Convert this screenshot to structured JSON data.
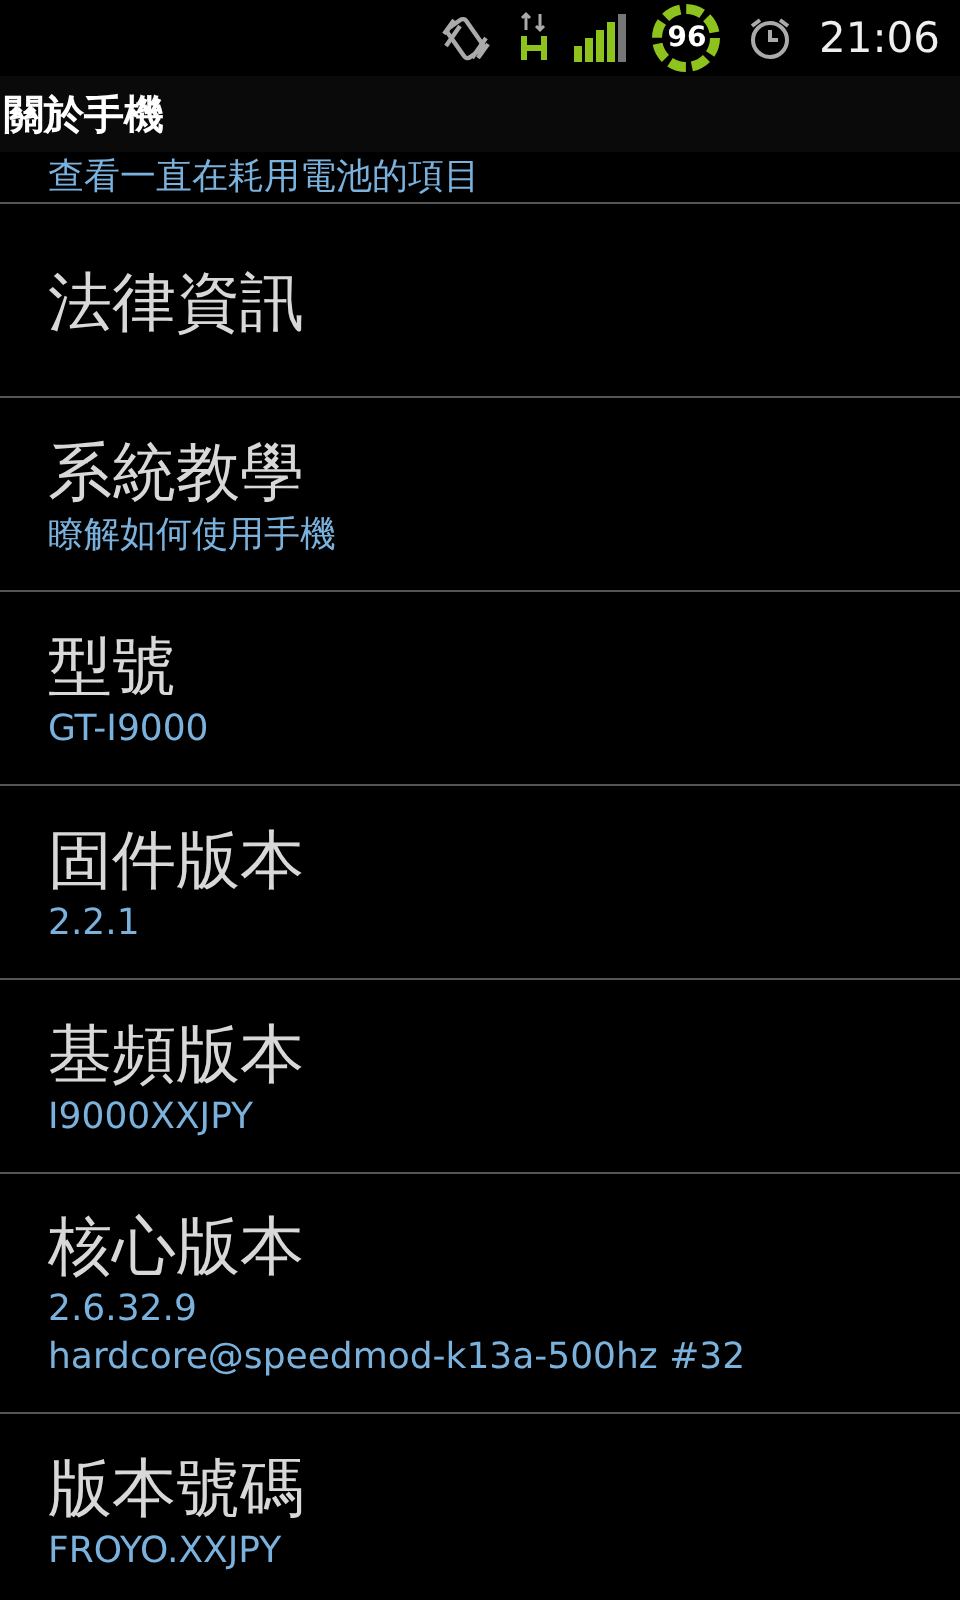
{
  "status_bar": {
    "battery": "96",
    "time": "21:06"
  },
  "window": {
    "title": "關於手機"
  },
  "items": [
    {
      "kind": "partial",
      "summary": [
        "查看一直在耗用電池的項目"
      ]
    },
    {
      "kind": "plain",
      "title": "法律資訊"
    },
    {
      "kind": "summary",
      "title": "系統教學",
      "summary": [
        "瞭解如何使用手機"
      ]
    },
    {
      "kind": "summary",
      "title": "型號",
      "summary": [
        "GT-I9000"
      ]
    },
    {
      "kind": "summary",
      "title": "固件版本",
      "summary": [
        "2.2.1"
      ]
    },
    {
      "kind": "summary",
      "title": "基頻版本",
      "summary": [
        "I9000XXJPY"
      ]
    },
    {
      "kind": "summary",
      "title": "核心版本",
      "summary": [
        "2.6.32.9",
        "hardcore@speedmod-k13a-500hz #32"
      ]
    },
    {
      "kind": "summary",
      "title": "版本號碼",
      "summary": [
        "FROYO.XXJPY"
      ]
    }
  ]
}
